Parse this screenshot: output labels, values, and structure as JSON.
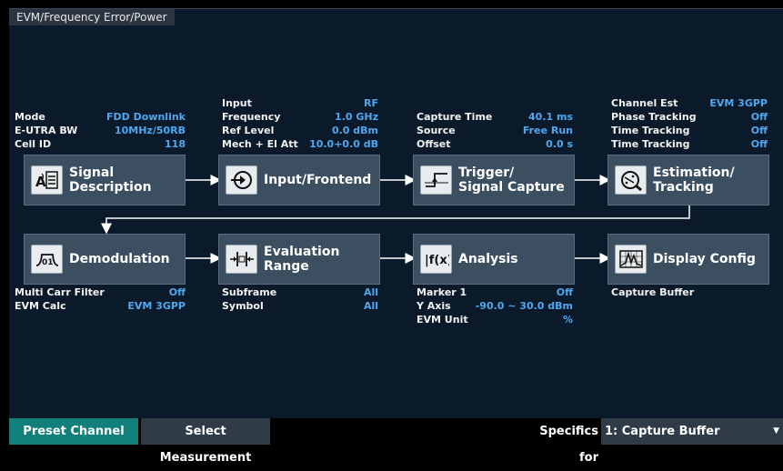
{
  "panel": {
    "title": "EVM/Frequency Error/Power"
  },
  "signal_info": [
    {
      "label": "Mode",
      "value": "FDD Downlink"
    },
    {
      "label": "E-UTRA BW",
      "value": "10MHz/50RB"
    },
    {
      "label": "Cell ID",
      "value": "118"
    }
  ],
  "input_info": [
    {
      "label": "Input",
      "value": "RF"
    },
    {
      "label": "Frequency",
      "value": "1.0 GHz"
    },
    {
      "label": "Ref Level",
      "value": "0.0 dBm"
    },
    {
      "label": "Mech + El Att",
      "value": "10.0+0.0 dB"
    }
  ],
  "trigger_info": [
    {
      "label": "Capture Time",
      "value": "40.1 ms"
    },
    {
      "label": "Source",
      "value": "Free Run"
    },
    {
      "label": "Offset",
      "value": "0.0 s"
    }
  ],
  "estimation_info": [
    {
      "label": "Channel Est",
      "value": "EVM 3GPP"
    },
    {
      "label": "Phase Tracking",
      "value": "Off"
    },
    {
      "label": "Time Tracking",
      "value": "Off"
    },
    {
      "label": "Time Tracking",
      "value": "Off"
    }
  ],
  "demod_info": [
    {
      "label": "Multi Carr Filter",
      "value": "Off"
    },
    {
      "label": "EVM Calc",
      "value": "EVM 3GPP"
    }
  ],
  "eval_info": [
    {
      "label": "Subframe",
      "value": "All"
    },
    {
      "label": "Symbol",
      "value": "All"
    }
  ],
  "analysis_info": [
    {
      "label": "Marker 1",
      "value": "Off"
    },
    {
      "label": "Y Axis",
      "value": "-90.0 ~ 30.0 dBm"
    },
    {
      "label": "EVM Unit",
      "value": "%"
    }
  ],
  "display_info": [
    {
      "label": "Capture Buffer",
      "value": ""
    }
  ],
  "blocks": {
    "signal": {
      "line1": "Signal",
      "line2": "Description",
      "icon": "signal-description-icon"
    },
    "input": {
      "line1": "Input/Frontend",
      "line2": "",
      "icon": "input-frontend-icon"
    },
    "trigger": {
      "line1": "Trigger/",
      "line2": "Signal Capture",
      "icon": "trigger-icon"
    },
    "estimation": {
      "line1": "Estimation/",
      "line2": "Tracking",
      "icon": "estimation-icon"
    },
    "demod": {
      "line1": "Demodulation",
      "line2": "",
      "icon": "demodulation-icon"
    },
    "evaluation": {
      "line1": "Evaluation",
      "line2": "Range",
      "icon": "evaluation-range-icon"
    },
    "analysis": {
      "line1": "Analysis",
      "line2": "",
      "icon": "analysis-icon"
    },
    "display": {
      "line1": "Display Config",
      "line2": "",
      "icon": "display-config-icon"
    }
  },
  "bottom_bar": {
    "preset": "Preset Channel",
    "select_measurement": "Select Measurement",
    "specifics_label": "Specifics for",
    "specifics_value": "1: Capture Buffer"
  },
  "colors": {
    "accent": "#4ea8f0",
    "block": "#3b4f61",
    "preset_button": "#11807a",
    "panel_bg": "#0a1a2a"
  }
}
